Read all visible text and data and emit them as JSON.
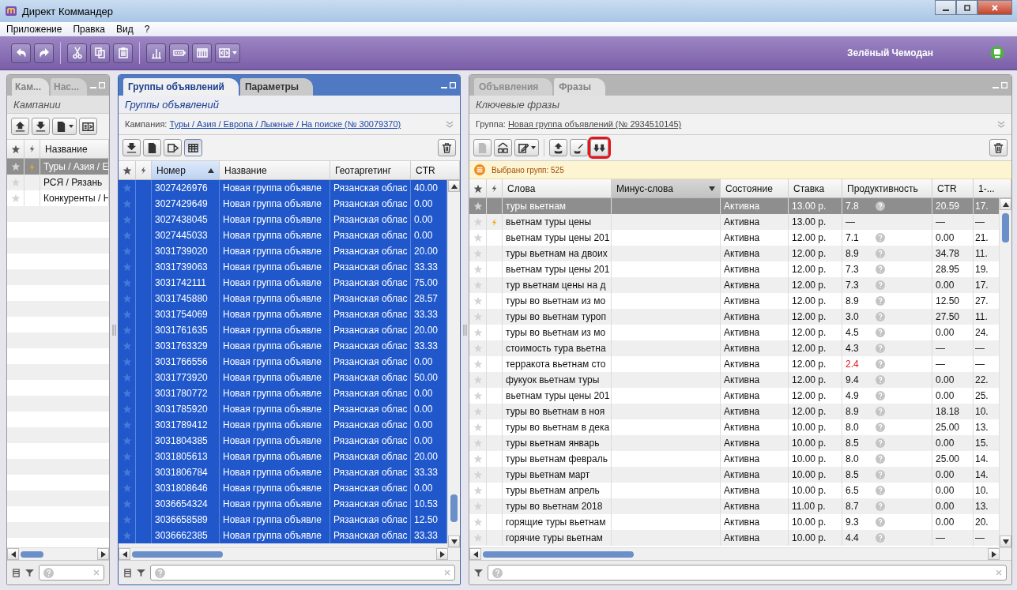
{
  "window": {
    "title": "Директ Коммандер"
  },
  "menu": [
    "Приложение",
    "Правка",
    "Вид",
    "?"
  ],
  "toolbar": [
    {
      "kind": "undo"
    },
    {
      "kind": "redo"
    },
    {
      "kind": "separator"
    },
    {
      "kind": "cut"
    },
    {
      "kind": "copy"
    },
    {
      "kind": "paste"
    },
    {
      "kind": "separator"
    },
    {
      "kind": "chart"
    },
    {
      "kind": "battery"
    },
    {
      "kind": "columns"
    },
    {
      "kind": "layout"
    }
  ],
  "user": "Зелёный Чемодан",
  "campaigns_panel": {
    "active": false,
    "tabs": [
      {
        "label": "Кам...",
        "selected": true
      },
      {
        "label": "Нас...",
        "selected": false
      }
    ],
    "subtitle": "Кампании",
    "toolbar": [
      {
        "kind": "upload"
      },
      {
        "kind": "download"
      },
      {
        "kind": "doc-menu"
      },
      {
        "kind": "split"
      }
    ],
    "columns": [
      {
        "label": "Название",
        "sorted": false
      }
    ],
    "rows": [
      {
        "name": "Туры / Азия / Е",
        "bolt": true,
        "selected": true
      },
      {
        "name": "РСЯ / Рязань",
        "bolt": false,
        "selected": false
      },
      {
        "name": "Конкуренты / Н",
        "bolt": false,
        "selected": false
      }
    ]
  },
  "groups_panel": {
    "active": true,
    "tabs": [
      {
        "label": "Группы объявлений",
        "selected": true
      },
      {
        "label": "Параметры",
        "selected": false
      }
    ],
    "subtitle": "Группы объявлений",
    "context": {
      "label": "Кампания:",
      "link": "Туры / Азия / Европа / Лыжные / На поиске (№ 30079370)"
    },
    "toolbar": [
      {
        "kind": "download"
      },
      {
        "kind": "doc"
      },
      {
        "kind": "export"
      },
      {
        "kind": "table",
        "pressed": true
      }
    ],
    "columns": [
      {
        "label": "Номер",
        "sorted": true,
        "descending": false
      },
      {
        "label": "Название",
        "sorted": false
      },
      {
        "label": "Геотаргетинг",
        "sorted": false
      },
      {
        "label": "CTR",
        "sorted": false
      }
    ],
    "rows": [
      {
        "id": "3027426976",
        "name": "Новая группа объявле",
        "geo": "Рязанская облас",
        "ctr": "40.00",
        "selected": true
      },
      {
        "id": "3027429649",
        "name": "Новая группа объявле",
        "geo": "Рязанская облас",
        "ctr": "0.00",
        "selected": true
      },
      {
        "id": "3027438045",
        "name": "Новая группа объявле",
        "geo": "Рязанская облас",
        "ctr": "0.00",
        "selected": true
      },
      {
        "id": "3027445033",
        "name": "Новая группа объявле",
        "geo": "Рязанская облас",
        "ctr": "0.00",
        "selected": true
      },
      {
        "id": "3031739020",
        "name": "Новая группа объявле",
        "geo": "Рязанская облас",
        "ctr": "20.00",
        "selected": true
      },
      {
        "id": "3031739063",
        "name": "Новая группа объявле",
        "geo": "Рязанская облас",
        "ctr": "33.33",
        "selected": true
      },
      {
        "id": "3031742111",
        "name": "Новая группа объявле",
        "geo": "Рязанская облас",
        "ctr": "75.00",
        "selected": true
      },
      {
        "id": "3031745880",
        "name": "Новая группа объявле",
        "geo": "Рязанская облас",
        "ctr": "28.57",
        "selected": true
      },
      {
        "id": "3031754069",
        "name": "Новая группа объявле",
        "geo": "Рязанская облас",
        "ctr": "33.33",
        "selected": true
      },
      {
        "id": "3031761635",
        "name": "Новая группа объявле",
        "geo": "Рязанская облас",
        "ctr": "20.00",
        "selected": true
      },
      {
        "id": "3031763329",
        "name": "Новая группа объявле",
        "geo": "Рязанская облас",
        "ctr": "33.33",
        "selected": true
      },
      {
        "id": "3031766556",
        "name": "Новая группа объявле",
        "geo": "Рязанская облас",
        "ctr": "0.00",
        "selected": true
      },
      {
        "id": "3031773920",
        "name": "Новая группа объявле",
        "geo": "Рязанская облас",
        "ctr": "50.00",
        "selected": true
      },
      {
        "id": "3031780772",
        "name": "Новая группа объявле",
        "geo": "Рязанская облас",
        "ctr": "0.00",
        "selected": true
      },
      {
        "id": "3031785920",
        "name": "Новая группа объявле",
        "geo": "Рязанская облас",
        "ctr": "0.00",
        "selected": true
      },
      {
        "id": "3031789412",
        "name": "Новая группа объявле",
        "geo": "Рязанская облас",
        "ctr": "0.00",
        "selected": true
      },
      {
        "id": "3031804385",
        "name": "Новая группа объявле",
        "geo": "Рязанская облас",
        "ctr": "0.00",
        "selected": true
      },
      {
        "id": "3031805613",
        "name": "Новая группа объявле",
        "geo": "Рязанская облас",
        "ctr": "20.00",
        "selected": true
      },
      {
        "id": "3031806784",
        "name": "Новая группа объявле",
        "geo": "Рязанская облас",
        "ctr": "33.33",
        "selected": true
      },
      {
        "id": "3031808646",
        "name": "Новая группа объявле",
        "geo": "Рязанская облас",
        "ctr": "0.00",
        "selected": true
      },
      {
        "id": "3036654324",
        "name": "Новая группа объявле",
        "geo": "Рязанская облас",
        "ctr": "10.53",
        "selected": true
      },
      {
        "id": "3036658589",
        "name": "Новая группа объявле",
        "geo": "Рязанская облас",
        "ctr": "12.50",
        "selected": true
      },
      {
        "id": "3036662385",
        "name": "Новая группа объявле",
        "geo": "Рязанская облас",
        "ctr": "33.33",
        "selected": true
      }
    ]
  },
  "phrases_panel": {
    "active": false,
    "tabs": [
      {
        "label": "Объявления",
        "selected": false
      },
      {
        "label": "Фразы",
        "selected": true
      }
    ],
    "subtitle": "Ключевые фразы",
    "context": {
      "label": "Группа:",
      "link": "Новая группа объявлений (№ 2934510145)"
    },
    "toolbar": [
      {
        "kind": "doc",
        "disabled": true
      },
      {
        "kind": "network"
      },
      {
        "kind": "edit-menu"
      },
      {
        "kind": "separator"
      },
      {
        "kind": "db-up"
      },
      {
        "kind": "db-wand"
      },
      {
        "kind": "double-down",
        "highlighted": true
      }
    ],
    "notice": "Выбрано групп: 525",
    "columns": [
      {
        "label": "Слова",
        "sorted": false
      },
      {
        "label": "Минус-слова",
        "sorted": true,
        "descending": true
      },
      {
        "label": "Состояние",
        "sorted": false
      },
      {
        "label": "Ставка",
        "sorted": false
      },
      {
        "label": "Продуктивность",
        "sorted": false
      },
      {
        "label": "CTR",
        "sorted": false
      },
      {
        "label": "1-...",
        "sorted": false
      }
    ],
    "rows": [
      {
        "words": "туры вьетнам",
        "status": "Активна",
        "bid": "13.00 р.",
        "prod": "7.8",
        "low": false,
        "hint": true,
        "ctr": "20.59",
        "col7": "17.",
        "bolt": false,
        "selected": true
      },
      {
        "words": "вьетнам туры цены",
        "status": "Активна",
        "bid": "13.00 р.",
        "prod": "—",
        "low": false,
        "hint": false,
        "ctr": "—",
        "col7": "—",
        "bolt": true,
        "selected": false
      },
      {
        "words": "вьетнам туры цены 201",
        "status": "Активна",
        "bid": "12.00 р.",
        "prod": "7.1",
        "low": false,
        "hint": true,
        "ctr": "0.00",
        "col7": "21.",
        "bolt": false,
        "selected": false
      },
      {
        "words": "туры вьетнам на двоих",
        "status": "Активна",
        "bid": "12.00 р.",
        "prod": "8.9",
        "low": false,
        "hint": true,
        "ctr": "34.78",
        "col7": "11.",
        "bolt": false,
        "selected": false
      },
      {
        "words": "вьетнам туры цены 201",
        "status": "Активна",
        "bid": "12.00 р.",
        "prod": "7.3",
        "low": false,
        "hint": true,
        "ctr": "28.95",
        "col7": "19.",
        "bolt": false,
        "selected": false
      },
      {
        "words": "тур вьетнам цены на д",
        "status": "Активна",
        "bid": "12.00 р.",
        "prod": "7.3",
        "low": false,
        "hint": true,
        "ctr": "0.00",
        "col7": "17.",
        "bolt": false,
        "selected": false
      },
      {
        "words": "туры во вьетнам из мо",
        "status": "Активна",
        "bid": "12.00 р.",
        "prod": "8.9",
        "low": false,
        "hint": true,
        "ctr": "12.50",
        "col7": "27.",
        "bolt": false,
        "selected": false
      },
      {
        "words": "туры во вьетнам туроп",
        "status": "Активна",
        "bid": "12.00 р.",
        "prod": "3.0",
        "low": false,
        "hint": true,
        "ctr": "27.50",
        "col7": "11.",
        "bolt": false,
        "selected": false
      },
      {
        "words": "туры во вьетнам из мо",
        "status": "Активна",
        "bid": "12.00 р.",
        "prod": "4.5",
        "low": false,
        "hint": true,
        "ctr": "0.00",
        "col7": "24.",
        "bolt": false,
        "selected": false
      },
      {
        "words": "стоимость тура вьетна",
        "status": "Активна",
        "bid": "12.00 р.",
        "prod": "4.3",
        "low": false,
        "hint": true,
        "ctr": "—",
        "col7": "—",
        "bolt": false,
        "selected": false
      },
      {
        "words": "терракота вьетнам сто",
        "status": "Активна",
        "bid": "12.00 р.",
        "prod": "2.4",
        "low": true,
        "hint": true,
        "ctr": "—",
        "col7": "—",
        "bolt": false,
        "selected": false
      },
      {
        "words": "фукуок вьетнам туры",
        "status": "Активна",
        "bid": "12.00 р.",
        "prod": "9.4",
        "low": false,
        "hint": true,
        "ctr": "0.00",
        "col7": "22.",
        "bolt": false,
        "selected": false
      },
      {
        "words": "вьетнам туры цены 201",
        "status": "Активна",
        "bid": "12.00 р.",
        "prod": "4.9",
        "low": false,
        "hint": true,
        "ctr": "0.00",
        "col7": "25.",
        "bolt": false,
        "selected": false
      },
      {
        "words": "туры во вьетнам в ноя",
        "status": "Активна",
        "bid": "12.00 р.",
        "prod": "8.9",
        "low": false,
        "hint": true,
        "ctr": "18.18",
        "col7": "10.",
        "bolt": false,
        "selected": false
      },
      {
        "words": "туры во вьетнам в дека",
        "status": "Активна",
        "bid": "10.00 р.",
        "prod": "8.0",
        "low": false,
        "hint": true,
        "ctr": "25.00",
        "col7": "13.",
        "bolt": false,
        "selected": false
      },
      {
        "words": "туры вьетнам январь",
        "status": "Активна",
        "bid": "10.00 р.",
        "prod": "8.5",
        "low": false,
        "hint": true,
        "ctr": "0.00",
        "col7": "15.",
        "bolt": false,
        "selected": false
      },
      {
        "words": "туры вьетнам февраль",
        "status": "Активна",
        "bid": "10.00 р.",
        "prod": "8.0",
        "low": false,
        "hint": true,
        "ctr": "25.00",
        "col7": "14.",
        "bolt": false,
        "selected": false
      },
      {
        "words": "туры вьетнам март",
        "status": "Активна",
        "bid": "10.00 р.",
        "prod": "8.5",
        "low": false,
        "hint": true,
        "ctr": "0.00",
        "col7": "14.",
        "bolt": false,
        "selected": false
      },
      {
        "words": "туры вьетнам апрель",
        "status": "Активна",
        "bid": "10.00 р.",
        "prod": "6.5",
        "low": false,
        "hint": true,
        "ctr": "0.00",
        "col7": "10.",
        "bolt": false,
        "selected": false
      },
      {
        "words": "туры во вьетнам 2018",
        "status": "Активна",
        "bid": "11.00 р.",
        "prod": "8.7",
        "low": false,
        "hint": true,
        "ctr": "0.00",
        "col7": "13.",
        "bolt": false,
        "selected": false
      },
      {
        "words": "горящие туры вьетнам",
        "status": "Активна",
        "bid": "10.00 р.",
        "prod": "9.3",
        "low": false,
        "hint": true,
        "ctr": "0.00",
        "col7": "20.",
        "bolt": false,
        "selected": false
      },
      {
        "words": "горячие туры вьетнам",
        "status": "Активна",
        "bid": "10.00 р.",
        "prod": "4.4",
        "low": false,
        "hint": true,
        "ctr": "—",
        "col7": "—",
        "bolt": false,
        "selected": false
      }
    ]
  }
}
